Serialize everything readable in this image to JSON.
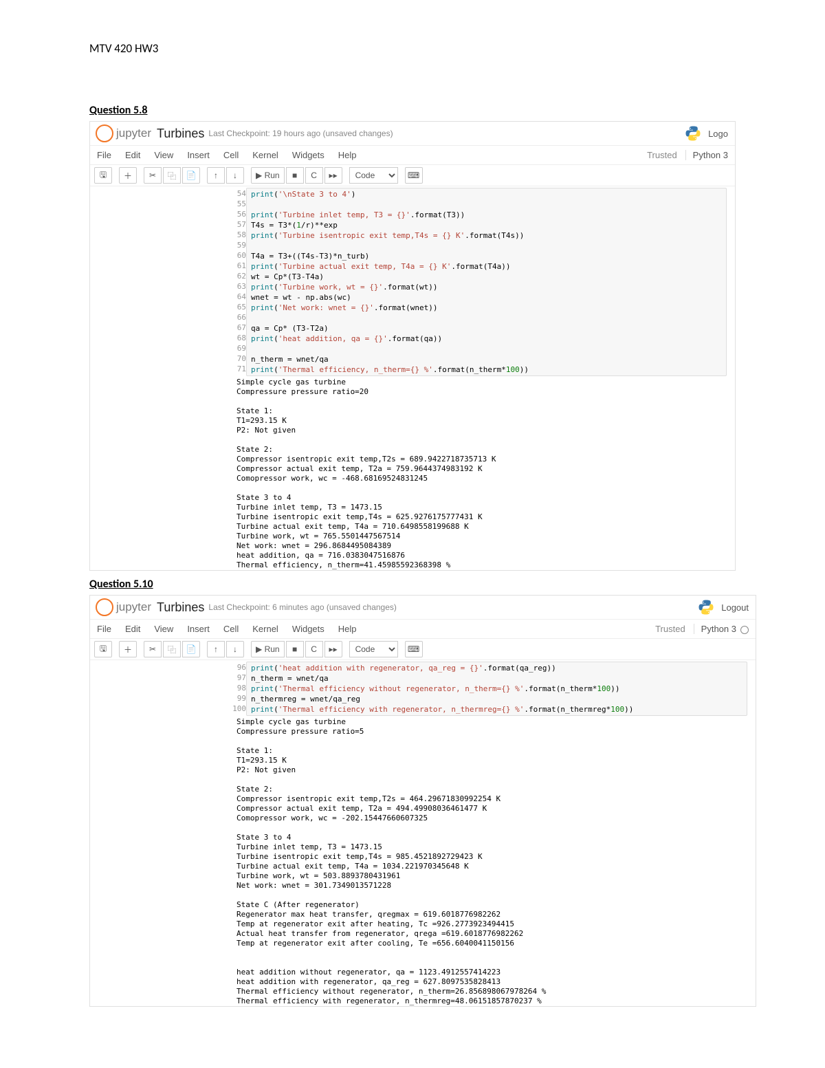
{
  "page_title": "MTV 420 HW3",
  "q1_heading": "Question 5.8",
  "q2_heading": "Question 5.10",
  "nb1": {
    "logo_text": "jupyter",
    "nb_name": "Turbines",
    "checkpoint": "Last Checkpoint: 19 hours ago  (unsaved changes)",
    "logout": "Logo",
    "menus": [
      "File",
      "Edit",
      "View",
      "Insert",
      "Cell",
      "Kernel",
      "Widgets",
      "Help"
    ],
    "trusted": "Trusted",
    "kernel": "Python 3",
    "run_label": "▶ Run",
    "celltype": "Code",
    "code_lines": [
      {
        "n": 54,
        "h": "<span class=\"s-builtin\">print</span>(<span class=\"s-string\">'\\nState 3 to 4'</span>)"
      },
      {
        "n": 55,
        "h": ""
      },
      {
        "n": 56,
        "h": "<span class=\"s-builtin\">print</span>(<span class=\"s-string\">'Turbine inlet temp, T3 = {}'</span>.format(T3))"
      },
      {
        "n": 57,
        "h": "T4s = T3*(<span class=\"s-num\">1</span>/r)**exp"
      },
      {
        "n": 58,
        "h": "<span class=\"s-builtin\">print</span>(<span class=\"s-string\">'Turbine isentropic exit temp,T4s = {} K'</span>.format(T4s))"
      },
      {
        "n": 59,
        "h": ""
      },
      {
        "n": 60,
        "h": "T4a = T3+((T4s-T3)*n_turb)"
      },
      {
        "n": 61,
        "h": "<span class=\"s-builtin\">print</span>(<span class=\"s-string\">'Turbine actual exit temp, T4a = {} K'</span>.format(T4a))"
      },
      {
        "n": 62,
        "h": "wt = Cp*(T3-T4a)"
      },
      {
        "n": 63,
        "h": "<span class=\"s-builtin\">print</span>(<span class=\"s-string\">'Turbine work, wt = {}'</span>.format(wt))"
      },
      {
        "n": 64,
        "h": "wnet = wt - np.abs(wc)"
      },
      {
        "n": 65,
        "h": "<span class=\"s-builtin\">print</span>(<span class=\"s-string\">'Net work: wnet = {}'</span>.format(wnet))"
      },
      {
        "n": 66,
        "h": ""
      },
      {
        "n": 67,
        "h": "qa = Cp* (T3-T2a)"
      },
      {
        "n": 68,
        "h": "<span class=\"s-builtin\">print</span>(<span class=\"s-string\">'heat addition, qa = {}'</span>.format(qa))"
      },
      {
        "n": 69,
        "h": ""
      },
      {
        "n": 70,
        "h": "n_therm = wnet/qa"
      },
      {
        "n": 71,
        "h": "<span class=\"s-builtin\">print</span>(<span class=\"s-string\">'Thermal efficiency, n_therm={} %'</span>.format(n_therm*<span class=\"s-num\">100</span>))"
      }
    ],
    "output": "Simple cycle gas turbine\nCompressure pressure ratio=20\n\nState 1:\nT1=293.15 K\nP2: Not given\n\nState 2:\nCompressor isentropic exit temp,T2s = 689.9422718735713 K\nCompressor actual exit temp, T2a = 759.9644374983192 K\nComopressor work, wc = -468.68169524831245\n\nState 3 to 4\nTurbine inlet temp, T3 = 1473.15\nTurbine isentropic exit temp,T4s = 625.9276175777431 K\nTurbine actual exit temp, T4a = 710.6498558199688 K\nTurbine work, wt = 765.5501447567514\nNet work: wnet = 296.8684495084389\nheat addition, qa = 716.0383047516876\nThermal efficiency, n_therm=41.45985592368398 %"
  },
  "nb2": {
    "logo_text": "jupyter",
    "nb_name": "Turbines",
    "checkpoint": "Last Checkpoint: 6 minutes ago  (unsaved changes)",
    "logout": "Logout",
    "menus": [
      "File",
      "Edit",
      "View",
      "Insert",
      "Cell",
      "Kernel",
      "Widgets",
      "Help"
    ],
    "trusted": "Trusted",
    "kernel": "Python 3",
    "run_label": "▶ Run",
    "celltype": "Code",
    "code_lines": [
      {
        "n": 96,
        "h": "<span class=\"s-builtin\">print</span>(<span class=\"s-string\">'heat addition with regenerator, qa_reg = {}'</span>.format(qa_reg))"
      },
      {
        "n": 97,
        "h": "n_therm = wnet/qa"
      },
      {
        "n": 98,
        "h": "<span class=\"s-builtin\">print</span>(<span class=\"s-string\">'Thermal efficiency without regenerator, n_therm={} %'</span>.format(n_therm*<span class=\"s-num\">100</span>))"
      },
      {
        "n": 99,
        "h": "n_thermreg = wnet/qa_reg"
      },
      {
        "n": 100,
        "h": "<span class=\"s-builtin\">print</span>(<span class=\"s-string\">'Thermal efficiency with regenerator, n_thermreg={} %'</span>.format(n_thermreg*<span class=\"s-num\">100</span>))"
      }
    ],
    "output": "Simple cycle gas turbine\nCompressure pressure ratio=5\n\nState 1:\nT1=293.15 K\nP2: Not given\n\nState 2:\nCompressor isentropic exit temp,T2s = 464.29671830992254 K\nCompressor actual exit temp, T2a = 494.49908036461477 K\nComopressor work, wc = -202.15447660607325\n\nState 3 to 4\nTurbine inlet temp, T3 = 1473.15\nTurbine isentropic exit temp,T4s = 985.4521892729423 K\nTurbine actual exit temp, T4a = 1034.221970345648 K\nTurbine work, wt = 503.8893780431961\nNet work: wnet = 301.7349013571228\n\nState C (After regenerator)\nRegenerator max heat transfer, qregmax = 619.6018776982262\nTemp at regenerator exit after heating, Tc =926.2773923494415\nActual heat transfer from regenerator, qrega =619.6018776982262\nTemp at regenerator exit after cooling, Te =656.6040041150156\n\n\nheat addition without regenerator, qa = 1123.4912557414223\nheat addition with regenerator, qa_reg = 627.8097535828413\nThermal efficiency without regenerator, n_therm=26.856898067978264 %\nThermal efficiency with regenerator, n_thermreg=48.06151857870237 %"
  }
}
